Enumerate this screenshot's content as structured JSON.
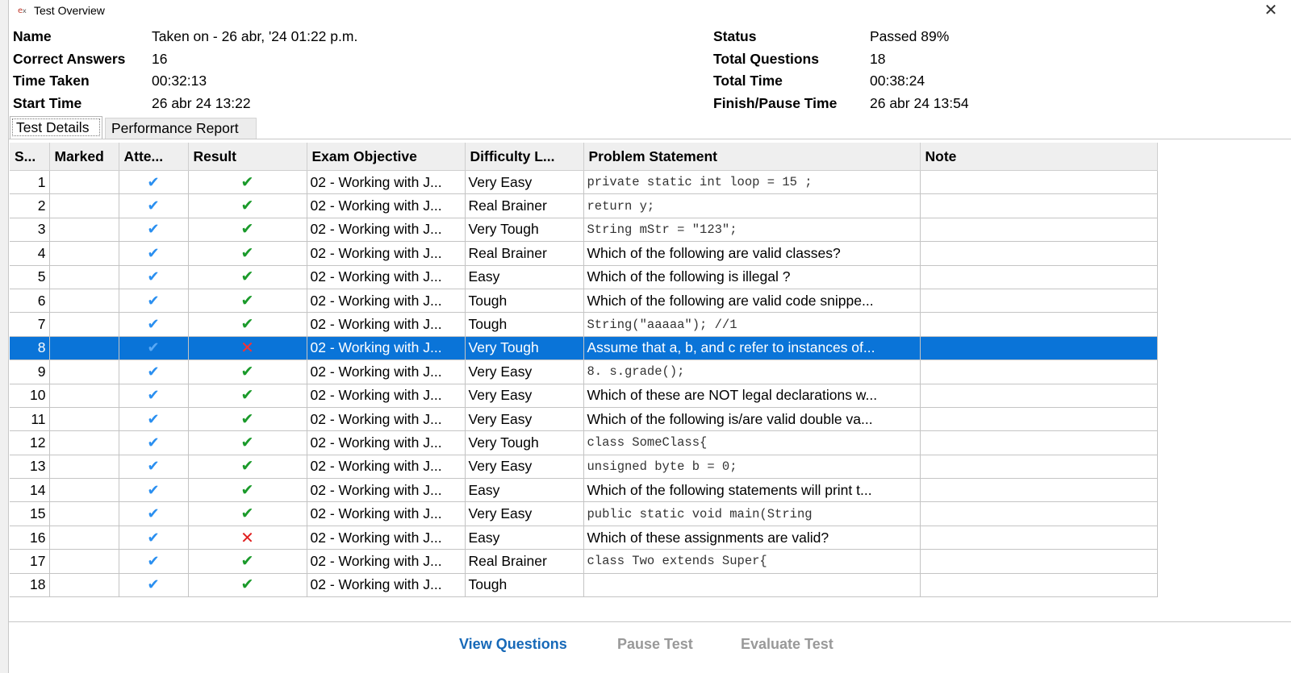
{
  "window": {
    "title": "Test Overview",
    "icon": "exam-app-icon"
  },
  "summary_left": [
    {
      "label": "Name",
      "value": "Taken on - 26 abr, '24 01:22 p.m."
    },
    {
      "label": "Correct Answers",
      "value": "16"
    },
    {
      "label": "Time Taken",
      "value": "00:32:13"
    },
    {
      "label": "Start Time",
      "value": "26 abr 24 13:22"
    }
  ],
  "summary_right": [
    {
      "label": "Status",
      "value": "Passed 89%"
    },
    {
      "label": "Total Questions",
      "value": "18"
    },
    {
      "label": "Total Time",
      "value": "00:38:24"
    },
    {
      "label": "Finish/Pause Time",
      "value": "26 abr 24 13:54"
    }
  ],
  "tabs": [
    {
      "label": "Test Details",
      "active": true
    },
    {
      "label": "Performance Report",
      "active": false
    }
  ],
  "columns": [
    "S...",
    "Marked",
    "Atte...",
    "Result",
    "Exam Objective",
    "Difficulty L...",
    "Problem Statement",
    "Note"
  ],
  "rows": [
    {
      "num": "1",
      "result": "correct",
      "objective": "02 - Working with J...",
      "difficulty": "Very Easy",
      "problem": "        private static int loop = 15 ;",
      "mono": true
    },
    {
      "num": "2",
      "result": "correct",
      "objective": "02 - Working with J...",
      "difficulty": "Real Brainer",
      "problem": "        return y;",
      "mono": true
    },
    {
      "num": "3",
      "result": "correct",
      "objective": "02 - Working with J...",
      "difficulty": "Very Tough",
      "problem": "String mStr = \"123\";",
      "mono": true
    },
    {
      "num": "4",
      "result": "correct",
      "objective": "02 - Working with J...",
      "difficulty": "Real Brainer",
      "problem": "Which of the following are valid classes?",
      "mono": false
    },
    {
      "num": "5",
      "result": "correct",
      "objective": "02 - Working with J...",
      "difficulty": "Easy",
      "problem": "Which of the following is illegal ?",
      "mono": false
    },
    {
      "num": "6",
      "result": "correct",
      "objective": "02 - Working with J...",
      "difficulty": "Tough",
      "problem": "Which of the following are valid code snippe...",
      "mono": false
    },
    {
      "num": "7",
      "result": "correct",
      "objective": "02 - Working with J...",
      "difficulty": "Tough",
      "problem": "String(\"aaaaa\");   //1",
      "mono": true
    },
    {
      "num": "8",
      "result": "wrong",
      "objective": "02 - Working with J...",
      "difficulty": "Very Tough",
      "problem": "Assume that a, b, and c refer to instances of...",
      "mono": false,
      "selected": true
    },
    {
      "num": "9",
      "result": "correct",
      "objective": "02 - Working with J...",
      "difficulty": "Very Easy",
      "problem": "8.      s.grade();",
      "mono": true
    },
    {
      "num": "10",
      "result": "correct",
      "objective": "02 - Working with J...",
      "difficulty": "Very Easy",
      "problem": "Which of these are NOT legal declarations w...",
      "mono": false
    },
    {
      "num": "11",
      "result": "correct",
      "objective": "02 - Working with J...",
      "difficulty": "Very Easy",
      "problem": "Which of the following is/are valid double va...",
      "mono": false
    },
    {
      "num": "12",
      "result": "correct",
      "objective": "02 - Working with J...",
      "difficulty": "Very Tough",
      "problem": "class SomeClass{",
      "mono": true
    },
    {
      "num": "13",
      "result": "correct",
      "objective": "02 - Working with J...",
      "difficulty": "Very Easy",
      "problem": "    unsigned byte b = 0;",
      "mono": true
    },
    {
      "num": "14",
      "result": "correct",
      "objective": "02 - Working with J...",
      "difficulty": "Easy",
      "problem": "Which of the following statements will print t...",
      "mono": false
    },
    {
      "num": "15",
      "result": "correct",
      "objective": "02 - Working with J...",
      "difficulty": "Very Easy",
      "problem": "   public static void main(String",
      "mono": true
    },
    {
      "num": "16",
      "result": "wrong",
      "objective": "02 - Working with J...",
      "difficulty": "Easy",
      "problem": "Which of these assignments are valid?",
      "mono": false
    },
    {
      "num": "17",
      "result": "correct",
      "objective": "02 - Working with J...",
      "difficulty": "Real Brainer",
      "problem": "class Two extends Super{",
      "mono": true
    },
    {
      "num": "18",
      "result": "correct",
      "objective": "02 - Working with J...",
      "difficulty": "Tough",
      "problem": "",
      "mono": true
    }
  ],
  "footer": {
    "view": "View Questions",
    "pause": "Pause Test",
    "evaluate": "Evaluate Test"
  },
  "colors": {
    "selected_row": "#0a74d8",
    "correct": "#1a9a2a",
    "wrong": "#e02020",
    "attempted": "#2a8ff0",
    "primary_button": "#1769b8"
  }
}
